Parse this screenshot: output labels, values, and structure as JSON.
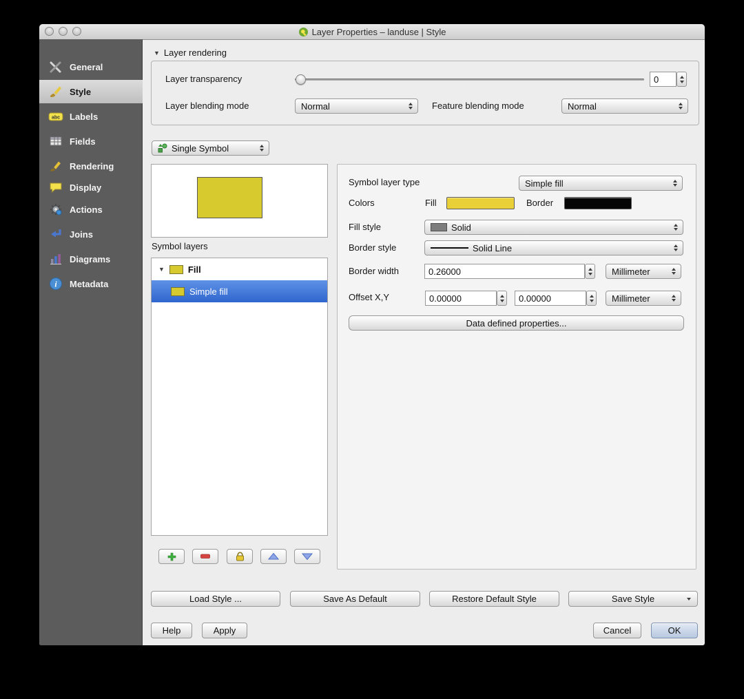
{
  "window": {
    "title": "Layer Properties – landuse | Style"
  },
  "sidebar": {
    "items": [
      {
        "label": "General"
      },
      {
        "label": "Style"
      },
      {
        "label": "Labels"
      },
      {
        "label": "Fields"
      },
      {
        "label": "Rendering"
      },
      {
        "label": "Display"
      },
      {
        "label": "Actions"
      },
      {
        "label": "Joins"
      },
      {
        "label": "Diagrams"
      },
      {
        "label": "Metadata"
      }
    ]
  },
  "layer_rendering": {
    "title": "Layer rendering",
    "transparency_label": "Layer transparency",
    "transparency_value": "0",
    "blending_mode_label": "Layer blending mode",
    "blending_mode_value": "Normal",
    "feature_blending_label": "Feature blending mode",
    "feature_blending_value": "Normal"
  },
  "symbol": {
    "type_selector_value": "Single Symbol",
    "symbol_layers_label": "Symbol layers",
    "tree": [
      {
        "label": "Fill"
      },
      {
        "label": "Simple fill"
      }
    ]
  },
  "properties": {
    "symbol_layer_type_label": "Symbol layer type",
    "symbol_layer_type_value": "Simple fill",
    "colors_label": "Colors",
    "fill_label": "Fill",
    "border_label": "Border",
    "fill_style_label": "Fill style",
    "fill_style_value": "Solid",
    "border_style_label": "Border style",
    "border_style_value": "Solid Line",
    "border_width_label": "Border width",
    "border_width_value": "0.26000",
    "border_width_unit": "Millimeter",
    "offset_label": "Offset X,Y",
    "offset_x_value": "0.00000",
    "offset_y_value": "0.00000",
    "offset_unit": "Millimeter",
    "data_defined_button_label": "Data defined properties..."
  },
  "style_actions": {
    "load_style": "Load Style ...",
    "save_as_default": "Save As Default",
    "restore_default": "Restore Default Style",
    "save_style": "Save Style"
  },
  "footer": {
    "help": "Help",
    "apply": "Apply",
    "cancel": "Cancel",
    "ok": "OK"
  },
  "colors": {
    "symbol_fill": "#d6ca2e",
    "fill_button": "#e9cf38",
    "border_button": "#060606",
    "selection_highlight": "#3a72d8",
    "fill_style_swatch": "#7d7d7d"
  }
}
